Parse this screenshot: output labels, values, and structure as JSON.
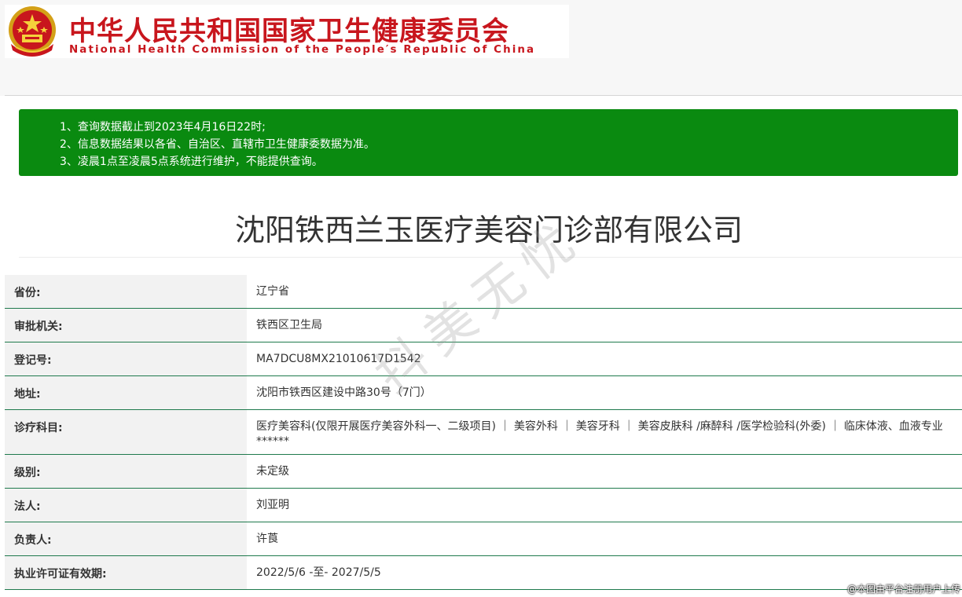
{
  "header": {
    "title_cn": "中华人民共和国国家卫生健康委员会",
    "title_en": "National Health Commission of the People′s Republic of China"
  },
  "notice": {
    "lines": [
      "1、查询数据截止到2023年4月16日22时;",
      "2、信息数据结果以各省、自治区、直辖市卫生健康委数据为准。",
      "3、凌晨1点至凌晨5点系统进行维护，不能提供查询。"
    ]
  },
  "company": {
    "name": "沈阳铁西兰玉医疗美容门诊部有限公司"
  },
  "info": {
    "rows": [
      {
        "label": "省份:",
        "value": "辽宁省"
      },
      {
        "label": "审批机关:",
        "value": "铁西区卫生局"
      },
      {
        "label": "登记号:",
        "value": "MA7DCU8MX21010617D1542"
      },
      {
        "label": "地址:",
        "value": "沈阳市铁西区建设中路30号（7门）"
      },
      {
        "label": "诊疗科目:",
        "value": "医疗美容科(仅限开展医疗美容外科一、二级项目) ｜ 美容外科 ｜ 美容牙科 ｜ 美容皮肤科 /麻醉科 /医学检验科(外委) ｜ 临床体液、血液专业******"
      },
      {
        "label": "级别:",
        "value": "未定级"
      },
      {
        "label": "法人:",
        "value": "刘亚明"
      },
      {
        "label": "负责人:",
        "value": "许莨"
      },
      {
        "label": "执业许可证有效期:",
        "value": "2022/5/6 -至- 2027/5/5"
      }
    ]
  },
  "watermark": "抖美无忧",
  "credit": "@本图由平台注册用户上传",
  "colors": {
    "brand_red": "#c8161d",
    "notice_green": "#0a8a10",
    "row_border": "#1f7a4d"
  }
}
